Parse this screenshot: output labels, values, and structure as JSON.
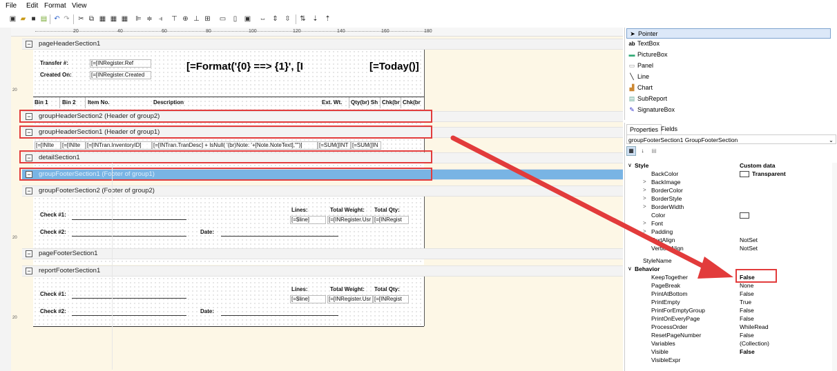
{
  "menu": [
    "File",
    "Edit",
    "Format",
    "View"
  ],
  "toolbar_icons": [
    "new-icon",
    "open-icon",
    "save-icon",
    "properties-icon",
    "undo-icon",
    "redo-icon",
    "cut-icon",
    "copy-icon",
    "paste-icon",
    "duplicate-icon",
    "delete-icon",
    "align-left-icon",
    "align-center-icon",
    "align-right-icon",
    "align-top-icon",
    "align-middle-icon",
    "align-bottom-icon",
    "align-grid-icon",
    "size-width-icon",
    "size-height-icon",
    "size-both-icon",
    "hspacing-icon",
    "vspacing-icon",
    "vspacing-equal-icon",
    "order-icon",
    "order-down-icon"
  ],
  "ruler": {
    "marks": [
      "20",
      "40",
      "60",
      "80",
      "100",
      "120",
      "140",
      "160",
      "180"
    ]
  },
  "vruler": [
    "20",
    "20",
    "20"
  ],
  "sections": [
    {
      "title": "pageHeaderSection1"
    },
    {
      "title": "groupHeaderSection2 (Header of group2)"
    },
    {
      "title": "groupHeaderSection1 (Header of group1)"
    },
    {
      "title": "detailSection1"
    },
    {
      "title": "groupFooterSection1 (Footer of group1)"
    },
    {
      "title": "groupFooterSection2 (Footer of group2)"
    },
    {
      "title": "pageFooterSection1"
    },
    {
      "title": "reportFooterSection1"
    }
  ],
  "page_header": {
    "transfer_label": "Transfer #:",
    "transfer_value": "[=[INRegister.Ref",
    "created_label": "Created On:",
    "created_value": "[=[INRegister.Created",
    "title_expr": "[=Format('{0} ==> {1}', [I",
    "today_expr": "[=Today()]",
    "columns": [
      "Bin 1",
      "Bin 2",
      "Item No.",
      "Description",
      "Ext. Wt.",
      "Qty(br) Sh",
      "Chk(br",
      "Chk(br"
    ]
  },
  "group_header1_fields": [
    "[=[INIte",
    "[=[INIte",
    "[=[INTran.InventoryID]",
    "[=[INTran.TranDesc] + IsNull( '(br)Note: '+[Note.NoteText],\"\")]",
    "[=SUM([INT",
    "[=SUM([IN"
  ],
  "group_footer2": {
    "check1": "Check #1:",
    "check2": "Check #2:",
    "date": "Date:",
    "lines": "Lines:",
    "lines_value": "[=$line]",
    "total_weight": "Total Weight:",
    "total_weight_value": "[=[INRegister.Usr",
    "total_qty": "Total Qty:",
    "total_qty_value": "[=[INRegist"
  },
  "report_footer": {
    "check1": "Check #1:",
    "check2": "Check #2:",
    "date": "Date:",
    "lines": "Lines:",
    "lines_value": "[=$line]",
    "total_weight": "Total Weight:",
    "total_weight_value": "[=[INRegister.Usr",
    "total_qty": "Total Qty:",
    "total_qty_value": "[=[INRegist"
  },
  "toolbox": [
    {
      "icon": "pointer-icon",
      "glyph": "➤",
      "label": "Pointer",
      "active": true
    },
    {
      "icon": "textbox-icon",
      "glyph": "ab",
      "label": "TextBox"
    },
    {
      "icon": "picturebox-icon",
      "glyph": "▬",
      "label": "PictureBox"
    },
    {
      "icon": "panel-icon",
      "glyph": "▭",
      "label": "Panel"
    },
    {
      "icon": "line-icon",
      "glyph": "╲",
      "label": "Line"
    },
    {
      "icon": "chart-icon",
      "glyph": "▟",
      "label": "Chart"
    },
    {
      "icon": "subreport-icon",
      "glyph": "▤",
      "label": "SubReport"
    },
    {
      "icon": "signaturebox-icon",
      "glyph": "✎",
      "label": "SignatureBox"
    }
  ],
  "props": {
    "tabs": [
      "Properties",
      "Fields"
    ],
    "selected_object": "groupFooterSection1 GroupFooterSection",
    "style_category": "Style",
    "style_value": "Custom data",
    "style_rows": [
      {
        "name": "BackColor",
        "value": "Transparent",
        "swatch": true,
        "bold": true
      },
      {
        "name": "BackImage",
        "value": "",
        "expand": true
      },
      {
        "name": "BorderColor",
        "value": "",
        "expand": true
      },
      {
        "name": "BorderStyle",
        "value": "",
        "expand": true
      },
      {
        "name": "BorderWidth",
        "value": "",
        "expand": true
      },
      {
        "name": "Color",
        "value": "",
        "swatch": true
      },
      {
        "name": "Font",
        "value": "",
        "expand": true
      },
      {
        "name": "Padding",
        "value": "",
        "expand": true
      },
      {
        "name": "TextAlign",
        "value": "NotSet"
      },
      {
        "name": "VerticalAlign",
        "value": "NotSet"
      }
    ],
    "stylename_row": {
      "name": "StyleName",
      "value": ""
    },
    "behavior_category": "Behavior",
    "behavior_rows": [
      {
        "name": "KeepTogether",
        "value": "False",
        "bold": true
      },
      {
        "name": "PageBreak",
        "value": "None"
      },
      {
        "name": "PrintAtBottom",
        "value": "False"
      },
      {
        "name": "PrintEmpty",
        "value": "True"
      },
      {
        "name": "PrintForEmptyGroup",
        "value": "False"
      },
      {
        "name": "PrintOnEveryPage",
        "value": "False"
      },
      {
        "name": "ProcessOrder",
        "value": "WhileRead"
      },
      {
        "name": "ResetPageNumber",
        "value": "False"
      },
      {
        "name": "Variables",
        "value": "(Collection)"
      },
      {
        "name": "Visible",
        "value": "False",
        "bold": true
      },
      {
        "name": "VisibleExpr",
        "value": ""
      }
    ]
  },
  "colors": {
    "highlight": "#e23b3b",
    "selected_section": "#79b4e4",
    "designer_bg": "#fdf7e6"
  }
}
